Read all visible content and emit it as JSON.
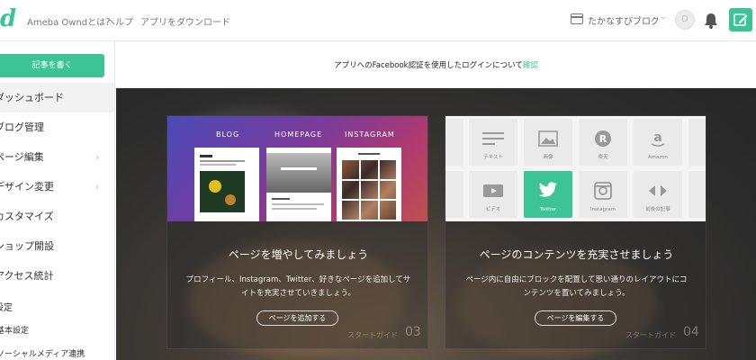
{
  "header": {
    "logo_text": "d",
    "nav": [
      "Ameba Owndとは？",
      "ヘルプ",
      "アプリをダウンロード"
    ],
    "blog_name": "たかなすびブログ",
    "avatar_letter": "D"
  },
  "sidebar": {
    "write_button": "記事を書く",
    "items": [
      {
        "label": "ダッシュボード",
        "active": true
      },
      {
        "label": "ブログ管理"
      },
      {
        "label": "ページ編集",
        "chevron": true
      },
      {
        "label": "デザイン変更",
        "chevron": true
      },
      {
        "label": "カスタマイズ"
      },
      {
        "label": "ショップ開設"
      },
      {
        "label": "アクセス統計"
      }
    ],
    "section_label": "設定",
    "sub_items": [
      "基本設定",
      "ソーシャルメディア連携"
    ]
  },
  "notice": {
    "text": "アプリへのFacebook認証を使用したログインについて",
    "link": "確認"
  },
  "cards": [
    {
      "tabs": [
        "BLOG",
        "HOMEPAGE",
        "INSTAGRAM"
      ],
      "title": "ページを増やしてみましょう",
      "desc": "プロフィール、Instagram、Twitter、好きなページを追加してサイトを充実させていきましょう。",
      "button": "ページを追加する",
      "guide_label": "スタートガイド",
      "guide_num": "03"
    },
    {
      "blocks_row1": [
        "テキスト",
        "画像",
        "楽天",
        "Amazon"
      ],
      "blocks_row2": [
        "ビデオ",
        "Twitter",
        "Instagram",
        "前後の記事"
      ],
      "title": "ページのコンテンツを充実させましょう",
      "desc": "ページ内に自由にブロックを配置して思い通りのレイアウトにコンテンツを置いてみましょう。",
      "button": "ページを編集する",
      "guide_label": "スタートガイド",
      "guide_num": "04"
    }
  ],
  "colors": {
    "accent": "#3cc497"
  }
}
